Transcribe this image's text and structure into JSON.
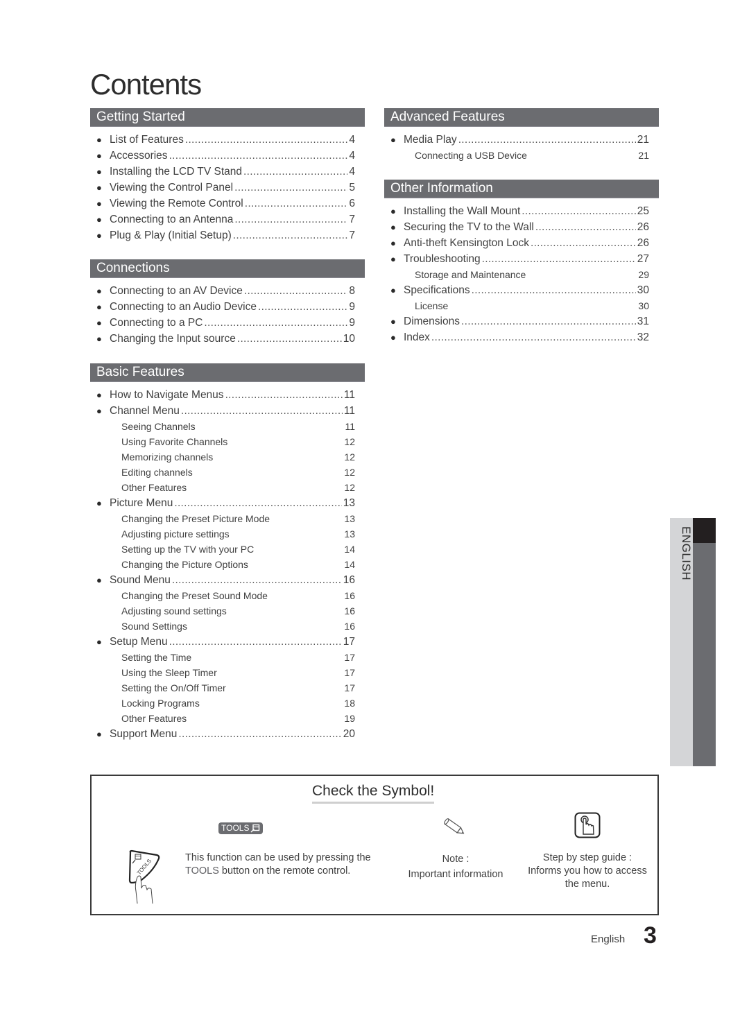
{
  "page_title": "Contents",
  "left_column": [
    {
      "title": "Getting Started",
      "items": [
        {
          "label": "List of Features",
          "page": "4"
        },
        {
          "label": "Accessories",
          "page": "4"
        },
        {
          "label": "Installing the LCD TV Stand",
          "page": "4"
        },
        {
          "label": "Viewing the Control Panel",
          "page": "5"
        },
        {
          "label": "Viewing the Remote Control",
          "page": "6"
        },
        {
          "label": "Connecting to an Antenna",
          "page": "7"
        },
        {
          "label": "Plug & Play (Initial Setup)",
          "page": "7"
        }
      ]
    },
    {
      "title": "Connections",
      "items": [
        {
          "label": "Connecting to an AV Device",
          "page": "8"
        },
        {
          "label": "Connecting to an Audio Device",
          "page": "9"
        },
        {
          "label": "Connecting to a PC",
          "page": "9"
        },
        {
          "label": "Changing the Input source",
          "page": "10"
        }
      ]
    },
    {
      "title": "Basic Features",
      "items": [
        {
          "label": "How to Navigate Menus",
          "page": "11"
        },
        {
          "label": "Channel Menu",
          "page": "11",
          "subs": [
            {
              "label": "Seeing Channels",
              "page": "11"
            },
            {
              "label": "Using Favorite Channels",
              "page": "12"
            },
            {
              "label": "Memorizing channels",
              "page": "12"
            },
            {
              "label": "Editing channels",
              "page": "12"
            },
            {
              "label": "Other Features",
              "page": "12"
            }
          ]
        },
        {
          "label": "Picture Menu",
          "page": "13",
          "subs": [
            {
              "label": "Changing the Preset Picture Mode",
              "page": "13"
            },
            {
              "label": "Adjusting picture settings",
              "page": "13"
            },
            {
              "label": "Setting up the TV with your PC",
              "page": "14"
            },
            {
              "label": "Changing the Picture Options",
              "page": "14"
            }
          ]
        },
        {
          "label": "Sound Menu",
          "page": "16",
          "subs": [
            {
              "label": "Changing the Preset Sound Mode",
              "page": "16"
            },
            {
              "label": "Adjusting sound settings",
              "page": "16"
            },
            {
              "label": "Sound Settings",
              "page": "16"
            }
          ]
        },
        {
          "label": "Setup Menu",
          "page": "17",
          "subs": [
            {
              "label": "Setting the Time",
              "page": "17"
            },
            {
              "label": "Using the Sleep Timer",
              "page": "17"
            },
            {
              "label": "Setting the On/Off Timer",
              "page": "17"
            },
            {
              "label": "Locking Programs",
              "page": "18"
            },
            {
              "label": "Other Features",
              "page": "19"
            }
          ]
        },
        {
          "label": "Support Menu",
          "page": "20"
        }
      ]
    }
  ],
  "right_column": [
    {
      "title": "Advanced Features",
      "items": [
        {
          "label": "Media Play",
          "page": "21",
          "subs": [
            {
              "label": "Connecting a USB Device",
              "page": "21"
            }
          ]
        }
      ]
    },
    {
      "title": "Other Information",
      "items": [
        {
          "label": "Installing the Wall Mount",
          "page": "25"
        },
        {
          "label": "Securing the TV to the Wall",
          "page": "26"
        },
        {
          "label": "Anti-theft Kensington Lock",
          "page": "26"
        },
        {
          "label": "Troubleshooting",
          "page": "27",
          "subs": [
            {
              "label": "Storage and Maintenance",
              "page": "29"
            }
          ]
        },
        {
          "label": "Specifications",
          "page": "30",
          "subs": [
            {
              "label": "License",
              "page": "30"
            }
          ]
        },
        {
          "label": "Dimensions",
          "page": "31"
        },
        {
          "label": "Index",
          "page": "32"
        }
      ]
    }
  ],
  "side_tab": {
    "language": "ENGLISH"
  },
  "symbols": {
    "title": "Check the Symbol!",
    "tools_badge": "TOOLS",
    "tools_description_prefix": "This function can be used by pressing the",
    "tools_keyword": "TOOLS",
    "tools_description_suffix": "button on the remote control.",
    "remote_button_label": "TOOLS",
    "note_title": "Note :",
    "note_description": "Important information",
    "guide_title": "Step by step guide :",
    "guide_description": "Informs you how to access the menu."
  },
  "footer": {
    "language": "English",
    "page_number": "3"
  }
}
